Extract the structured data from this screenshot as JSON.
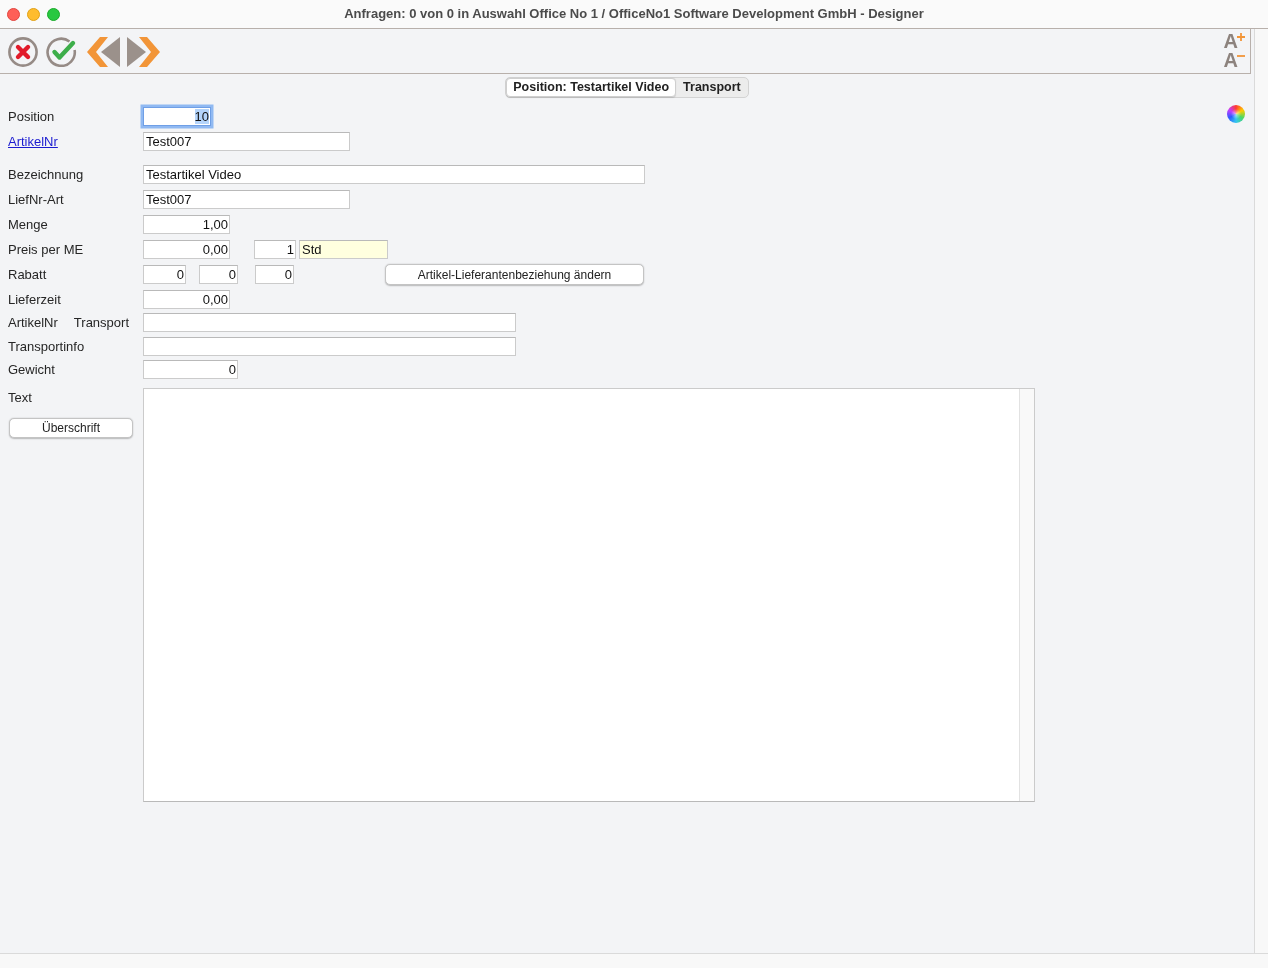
{
  "window": {
    "title": "Anfragen: 0 von 0 in Auswahl Office No 1 / OfficeNo1 Software Development GmbH - Designer"
  },
  "toolbar": {
    "font_buttons": [
      {
        "kind": "increase",
        "label": "A"
      },
      {
        "kind": "decrease",
        "label": "A"
      }
    ]
  },
  "tabs": [
    {
      "label": "Position: Testartikel Video",
      "selected": true
    },
    {
      "label": "Transport",
      "selected": false
    }
  ],
  "form": {
    "rows": [
      {
        "labels": [
          "Position"
        ],
        "link": false,
        "controls": [
          {
            "kind": "number",
            "value": "10",
            "focused": true
          }
        ]
      },
      {
        "labels": [
          "ArtikelNr"
        ],
        "link": true,
        "controls": [
          {
            "kind": "text",
            "value": "Test007",
            "focused": false
          }
        ]
      },
      {
        "labels": [
          "Bezeichnung"
        ],
        "link": false,
        "controls": [
          {
            "kind": "text",
            "value": "Testartikel Video",
            "focused": false
          }
        ]
      },
      {
        "labels": [
          "LiefNr-Art"
        ],
        "link": false,
        "controls": [
          {
            "kind": "text",
            "value": "Test007",
            "focused": false
          }
        ]
      },
      {
        "labels": [
          "Menge"
        ],
        "link": false,
        "controls": [
          {
            "kind": "number",
            "value": "1,00",
            "focused": false
          }
        ]
      },
      {
        "labels": [
          "Preis per ME"
        ],
        "link": false,
        "controls": [
          {
            "kind": "number",
            "value": "0,00",
            "focused": false
          },
          {
            "kind": "number",
            "value": "1",
            "focused": false
          },
          {
            "kind": "lookup",
            "value": "Std",
            "focused": false
          }
        ]
      },
      {
        "labels": [
          "Rabatt"
        ],
        "link": false,
        "controls": [
          {
            "kind": "number",
            "value": "0",
            "focused": false
          },
          {
            "kind": "number",
            "value": "0",
            "focused": false
          },
          {
            "kind": "number",
            "value": "0",
            "focused": false
          },
          {
            "kind": "button",
            "label": "Artikel-Lieferantenbeziehung ändern",
            "focused": false
          }
        ]
      },
      {
        "labels": [
          "Lieferzeit"
        ],
        "link": false,
        "controls": [
          {
            "kind": "number",
            "value": "0,00",
            "focused": false
          }
        ]
      },
      {
        "labels": [
          "ArtikelNr",
          "Transport"
        ],
        "link": false,
        "controls": [
          {
            "kind": "text",
            "focused": false
          }
        ]
      },
      {
        "labels": [
          "Transportinfo"
        ],
        "link": false,
        "controls": [
          {
            "kind": "text",
            "focused": false
          }
        ]
      },
      {
        "labels": [
          "Gewicht"
        ],
        "link": false,
        "controls": [
          {
            "kind": "number",
            "value": "0",
            "focused": false
          }
        ]
      },
      {
        "labels": [
          "Text"
        ],
        "link": false,
        "side_buttons": [
          "Überschrift"
        ],
        "controls": [
          {
            "kind": "textarea",
            "focused": false
          }
        ]
      }
    ]
  }
}
